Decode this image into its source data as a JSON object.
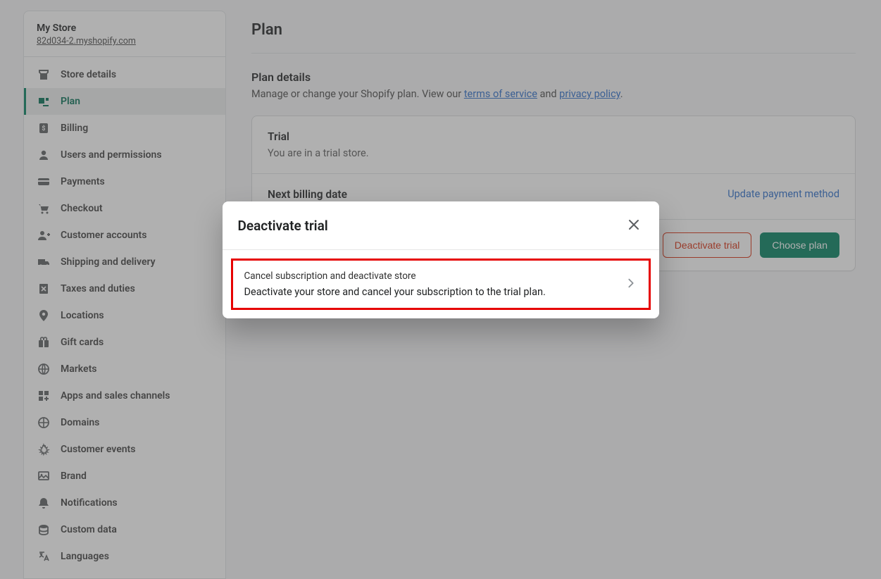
{
  "store": {
    "name": "My Store",
    "url": "82d034-2.myshopify.com"
  },
  "sidebar": {
    "items": [
      {
        "label": "Store details",
        "icon": "store-details-icon"
      },
      {
        "label": "Plan",
        "icon": "plan-icon",
        "active": true
      },
      {
        "label": "Billing",
        "icon": "billing-icon"
      },
      {
        "label": "Users and permissions",
        "icon": "users-icon"
      },
      {
        "label": "Payments",
        "icon": "payments-icon"
      },
      {
        "label": "Checkout",
        "icon": "checkout-icon"
      },
      {
        "label": "Customer accounts",
        "icon": "customer-accounts-icon"
      },
      {
        "label": "Shipping and delivery",
        "icon": "shipping-icon"
      },
      {
        "label": "Taxes and duties",
        "icon": "taxes-icon"
      },
      {
        "label": "Locations",
        "icon": "locations-icon"
      },
      {
        "label": "Gift cards",
        "icon": "gift-cards-icon"
      },
      {
        "label": "Markets",
        "icon": "markets-icon"
      },
      {
        "label": "Apps and sales channels",
        "icon": "apps-icon"
      },
      {
        "label": "Domains",
        "icon": "domains-icon"
      },
      {
        "label": "Customer events",
        "icon": "events-icon"
      },
      {
        "label": "Brand",
        "icon": "brand-icon"
      },
      {
        "label": "Notifications",
        "icon": "notifications-icon"
      },
      {
        "label": "Custom data",
        "icon": "custom-data-icon"
      },
      {
        "label": "Languages",
        "icon": "languages-icon"
      }
    ]
  },
  "page": {
    "title": "Plan",
    "details_heading": "Plan details",
    "details_text_prefix": "Manage or change your Shopify plan. View our ",
    "terms_link": "terms of service",
    "details_text_and": " and ",
    "privacy_link": "privacy policy",
    "details_text_suffix": "."
  },
  "card": {
    "trial_heading": "Trial",
    "trial_text": "You are in a trial store.",
    "next_billing_label": "Next billing date",
    "update_payment": "Update payment method",
    "deactivate_btn": "Deactivate trial",
    "choose_plan_btn": "Choose plan"
  },
  "modal": {
    "title": "Deactivate trial",
    "option_title": "Cancel subscription and deactivate store",
    "option_desc": "Deactivate your store and cancel your subscription to the trial plan."
  }
}
